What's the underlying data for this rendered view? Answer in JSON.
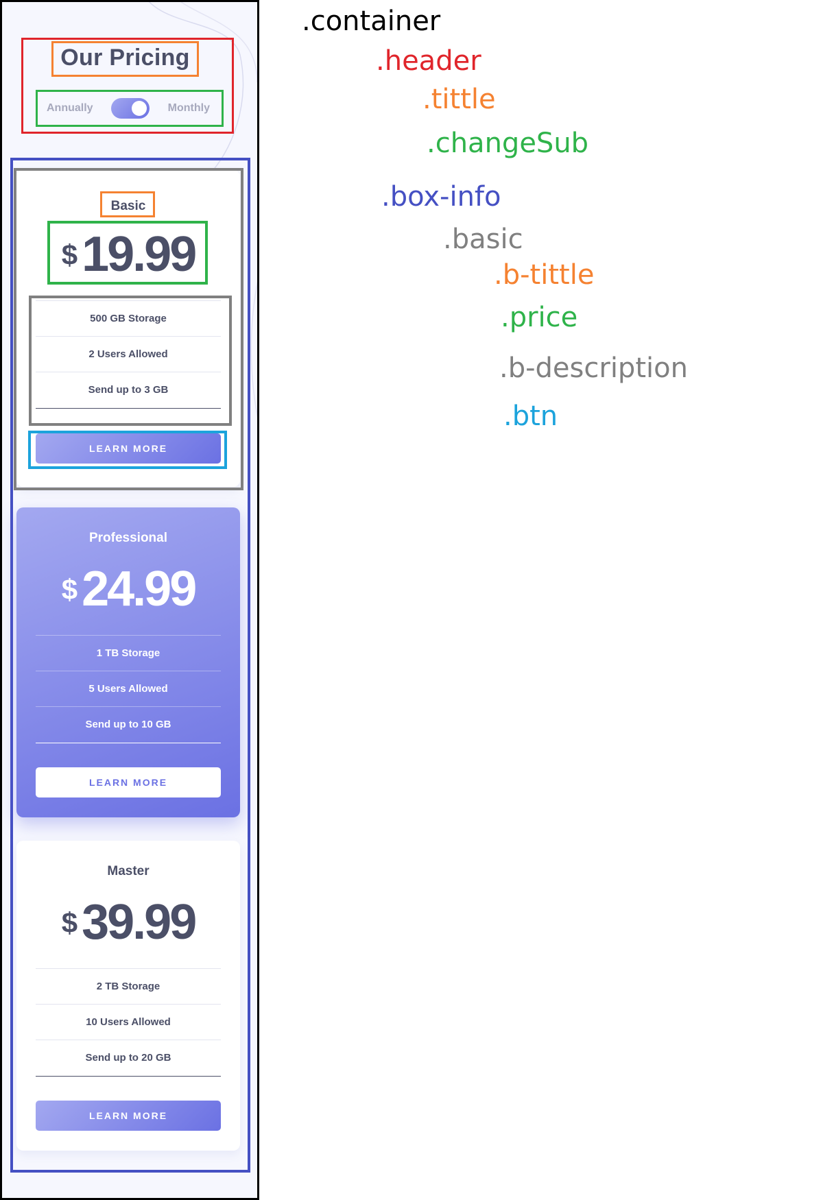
{
  "colors": {
    "container": "#000000",
    "header": "#e0252b",
    "title": "#f58231",
    "change_sub": "#2fb34a",
    "box_info": "#4550c3",
    "basic": "#808080",
    "btn": "#1ca3dc",
    "accent": "#6b71e3"
  },
  "header": {
    "title": "Our Pricing",
    "toggle": {
      "left_label": "Annually",
      "right_label": "Monthly",
      "state": "monthly"
    }
  },
  "plans": [
    {
      "name": "Basic",
      "currency": "$",
      "price": "19.99",
      "features": [
        "500 GB Storage",
        "2 Users Allowed",
        "Send up to 3 GB"
      ],
      "button": "LEARN MORE"
    },
    {
      "name": "Professional",
      "currency": "$",
      "price": "24.99",
      "features": [
        "1 TB Storage",
        "5 Users Allowed",
        "Send up to 10 GB"
      ],
      "button": "LEARN MORE"
    },
    {
      "name": "Master",
      "currency": "$",
      "price": "39.99",
      "features": [
        "2 TB Storage",
        "10 Users Allowed",
        "Send up to 20 GB"
      ],
      "button": "LEARN MORE"
    }
  ],
  "annotations": {
    "container": ".container",
    "header": ".header",
    "tittle": ".tittle",
    "changeSub": ".changeSub",
    "box_info": ".box-info",
    "basic": ".basic",
    "b_tittle": ".b-tittle",
    "price": ".price",
    "b_description": ".b-description",
    "btn": ".btn"
  }
}
